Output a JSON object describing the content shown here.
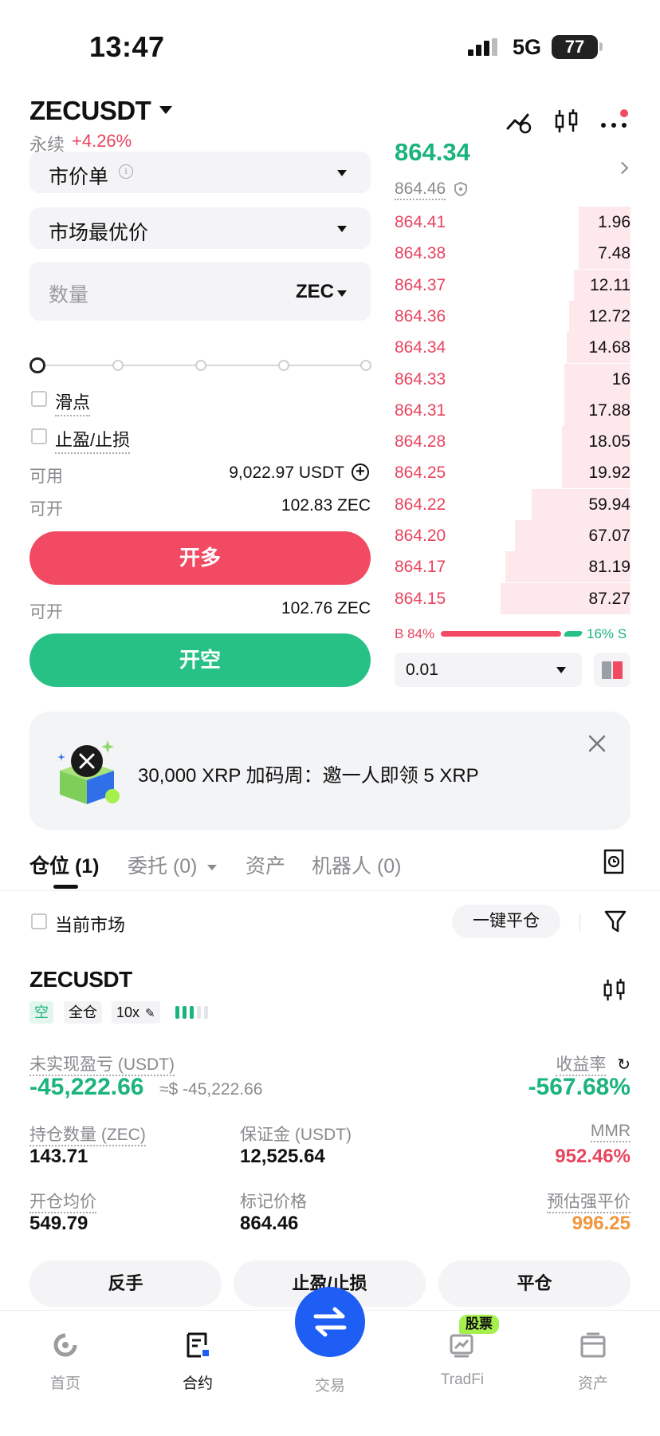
{
  "status_bar": {
    "time": "13:47",
    "network": "5G",
    "battery": "77"
  },
  "header": {
    "pair": "ZECUSDT",
    "type_label": "永续",
    "change": "+4.26%"
  },
  "order_form": {
    "order_type": "市价单",
    "price_type": "市场最优价",
    "quantity_placeholder": "数量",
    "quantity_unit": "ZEC",
    "slippage_label": "滑点",
    "tpsl_label": "止盈/止损",
    "available_label": "可用",
    "available_value": "9,022.97 USDT",
    "can_open_label": "可开",
    "can_open_long": "102.83 ZEC",
    "long_button": "开多",
    "can_open_short": "102.76 ZEC",
    "short_button": "开空"
  },
  "order_book": {
    "last_price": "864.34",
    "mark_price": "864.46",
    "asks": [
      {
        "price": "864.41",
        "qty": "1.96",
        "depth": 0.22
      },
      {
        "price": "864.38",
        "qty": "7.48",
        "depth": 0.22
      },
      {
        "price": "864.37",
        "qty": "12.11",
        "depth": 0.24
      },
      {
        "price": "864.36",
        "qty": "12.72",
        "depth": 0.26
      },
      {
        "price": "864.34",
        "qty": "14.68",
        "depth": 0.27
      },
      {
        "price": "864.33",
        "qty": "16",
        "depth": 0.28
      },
      {
        "price": "864.31",
        "qty": "17.88",
        "depth": 0.28
      },
      {
        "price": "864.28",
        "qty": "18.05",
        "depth": 0.29
      },
      {
        "price": "864.25",
        "qty": "19.92",
        "depth": 0.29
      },
      {
        "price": "864.22",
        "qty": "59.94",
        "depth": 0.42
      },
      {
        "price": "864.20",
        "qty": "67.07",
        "depth": 0.49
      },
      {
        "price": "864.17",
        "qty": "81.19",
        "depth": 0.53
      },
      {
        "price": "864.15",
        "qty": "87.27",
        "depth": 0.55
      }
    ],
    "buy_ratio": "B 84%",
    "sell_ratio": "16% S",
    "depth_step": "0.01"
  },
  "banner": {
    "text": "30,000 XRP 加码周：邀一人即领 5 XRP"
  },
  "tabs": [
    {
      "label": "仓位 (1)"
    },
    {
      "label": "委托 (0)"
    },
    {
      "label": "资产"
    },
    {
      "label": "机器人 (0)"
    }
  ],
  "filters": {
    "current_market": "当前市场",
    "close_all": "一键平仓"
  },
  "position": {
    "symbol": "ZECUSDT",
    "side": "空",
    "margin_mode": "全仓",
    "leverage": "10x",
    "pnl_label": "未实现盈亏 (USDT)",
    "pnl_value": "-45,222.66",
    "pnl_usd": "≈$ -45,222.66",
    "roe_label": "收益率",
    "roe_value": "-567.68%",
    "size_label": "持仓数量 (ZEC)",
    "size_value": "143.71",
    "margin_label": "保证金 (USDT)",
    "margin_value": "12,525.64",
    "mmr_label": "MMR",
    "mmr_value": "952.46%",
    "entry_label": "开仓均价",
    "entry_value": "549.79",
    "mark_label": "标记价格",
    "mark_value": "864.46",
    "liq_label": "预估强平价",
    "liq_value": "996.25"
  },
  "actions": {
    "reverse": "反手",
    "tpsl": "止盈/止损",
    "close": "平仓"
  },
  "bottom_nav": {
    "home": "首页",
    "futures": "合约",
    "trade": "交易",
    "tradfi": "TradFi",
    "stock_badge": "股票",
    "assets": "资产"
  },
  "colors": {
    "up": "#1bb47c",
    "down": "#e8445e",
    "accent": "#1f5ef5",
    "warning": "#f0963c"
  }
}
